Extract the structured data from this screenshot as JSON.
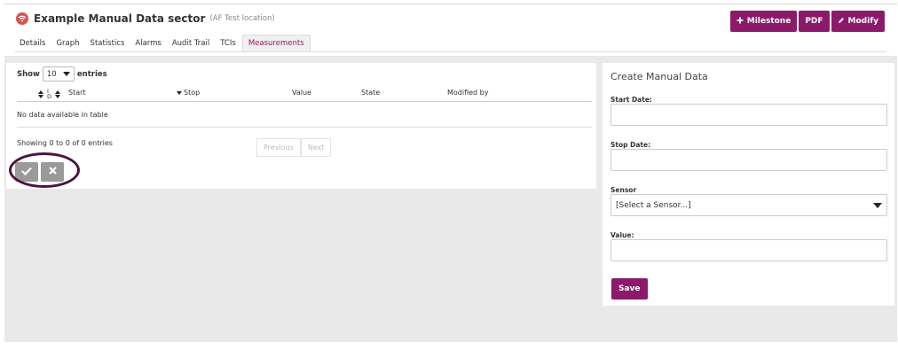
{
  "header": {
    "title": "Example Manual Data sector",
    "subtitle": "(AF Test location)",
    "icon": "wifi-icon",
    "buttons": {
      "milestone": "Milestone",
      "pdf": "PDF",
      "modify": "Modify"
    },
    "accent_color": "#8c1a6a"
  },
  "tabs": [
    {
      "label": "Details"
    },
    {
      "label": "Graph"
    },
    {
      "label": "Statistics"
    },
    {
      "label": "Alarms"
    },
    {
      "label": "Audit Trail"
    },
    {
      "label": "TCIs"
    },
    {
      "label": "Measurements",
      "active": true
    }
  ],
  "table": {
    "show_label": "Show",
    "entries_label": "entries",
    "page_size": "10",
    "id_sort_glyph_top": "I",
    "id_sort_glyph_bottom": "D",
    "columns": [
      "Start",
      "Stop",
      "Value",
      "State",
      "Modified by"
    ],
    "empty_text": "No data available in table",
    "info": "Showing 0 to 0 of 0 entries",
    "pagination": {
      "previous": "Previous",
      "next": "Next"
    }
  },
  "actions": {
    "confirm_icon": "check-icon",
    "cancel_icon": "close-icon"
  },
  "form": {
    "title": "Create Manual Data",
    "start_date_label": "Start Date:",
    "stop_date_label": "Stop Date:",
    "sensor_label": "Sensor",
    "sensor_value": "[Select a Sensor...]",
    "value_label": "Value:",
    "save_label": "Save"
  }
}
